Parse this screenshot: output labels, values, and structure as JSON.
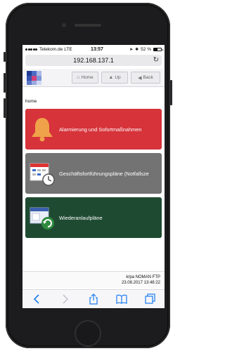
{
  "status_bar": {
    "carrier": "Telekom.de",
    "network": "LTE",
    "time": "13:57",
    "battery_percent": "52 %",
    "battery_level": 0.52
  },
  "browser": {
    "url": "192.168.137.1"
  },
  "app_header": {
    "home_label": "Home",
    "up_label": "Up",
    "back_label": "Back"
  },
  "breadcrumb": "home",
  "tiles": [
    {
      "label": "Alarmierung und Sofortmaßnahmen",
      "color": "#d6333a",
      "icon": "bell-icon"
    },
    {
      "label": "Geschäftsfortführungspläne (Notfallsze",
      "color": "#737373",
      "icon": "calendar-clock-icon"
    },
    {
      "label": "Wiederanlaufpläne",
      "color": "#1f4a32",
      "icon": "restart-window-icon"
    }
  ],
  "footer": {
    "user_line": "krpa NOMAN FTP",
    "timestamp": "23.08.2017 13:48:22"
  },
  "toolbar": {
    "icons": [
      "back-arrow-icon",
      "forward-arrow-icon",
      "share-icon",
      "bookmarks-icon",
      "tabs-icon"
    ]
  }
}
